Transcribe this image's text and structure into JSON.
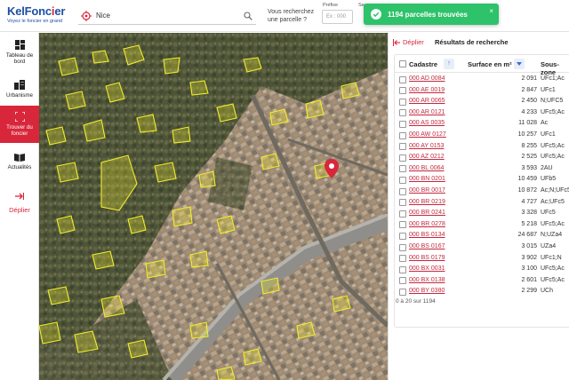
{
  "header": {
    "logo_main_a": "KelFonc",
    "logo_main_b": "i",
    "logo_main_c": "er",
    "logo_tagline": "Voyez le foncier en grand",
    "search_value": "Nice",
    "question": "Vous recherchez une parcelle ?",
    "prefix_label": "Préfixe",
    "prefix_placeholder": "Ex : 000",
    "section_label": "Se"
  },
  "toast": {
    "message": "1194 parcelles trouvées",
    "close": "×",
    "color": "#2ec26a"
  },
  "sidebar": {
    "items": [
      {
        "label": "Tableau de bord",
        "icon": "dashboard-icon"
      },
      {
        "label": "Urbanisme",
        "icon": "buildings-icon"
      },
      {
        "label": "Trouver du foncier",
        "icon": "expand-frame-icon",
        "active": true
      },
      {
        "label": "Actualités",
        "icon": "book-icon"
      }
    ],
    "deplier": "Déplier",
    "accent": "#d8263b"
  },
  "panel": {
    "deplier": "Déplier",
    "title": "Résultats de recherche",
    "columns": [
      "Cadastre",
      "Surface en m²",
      "Sous-zone"
    ],
    "rows": [
      {
        "cadastre": "000 AD 0084",
        "surface": "2 091",
        "zone": "UFc1;Ac"
      },
      {
        "cadastre": "000 AE 0019",
        "surface": "2 847",
        "zone": "UFc1"
      },
      {
        "cadastre": "000 AR 0065",
        "surface": "2 450",
        "zone": "N;UFC5"
      },
      {
        "cadastre": "000 AR 0121",
        "surface": "4 233",
        "zone": "UFc5;Ac"
      },
      {
        "cadastre": "000 AS 0035",
        "surface": "11 028",
        "zone": "Ac"
      },
      {
        "cadastre": "000 AW 0127",
        "surface": "10 257",
        "zone": "UFc1"
      },
      {
        "cadastre": "000 AY 0153",
        "surface": "8 255",
        "zone": "UFc5;Ac"
      },
      {
        "cadastre": "000 AZ 0212",
        "surface": "2 525",
        "zone": "UFc5;Ac"
      },
      {
        "cadastre": "000 BL 0064",
        "surface": "3 593",
        "zone": "2AU"
      },
      {
        "cadastre": "000 BN 0201",
        "surface": "10 459",
        "zone": "UFb5"
      },
      {
        "cadastre": "000 BR 0017",
        "surface": "10 872",
        "zone": "Ac;N;UFc5"
      },
      {
        "cadastre": "000 BR 0219",
        "surface": "4 727",
        "zone": "Ac;UFc5"
      },
      {
        "cadastre": "000 BR 0241",
        "surface": "3 328",
        "zone": "UFc5"
      },
      {
        "cadastre": "000 BR 0278",
        "surface": "5 218",
        "zone": "UFc5;Ac"
      },
      {
        "cadastre": "000 BS 0134",
        "surface": "24 687",
        "zone": "N;UZa4"
      },
      {
        "cadastre": "000 BS 0167",
        "surface": "3 015",
        "zone": "UZa4"
      },
      {
        "cadastre": "000 BS 0179",
        "surface": "3 902",
        "zone": "UFc1;N"
      },
      {
        "cadastre": "000 BX 0031",
        "surface": "3 100",
        "zone": "UFc5;Ac"
      },
      {
        "cadastre": "000 BX 0138",
        "surface": "2 601",
        "zone": "UFc5;Ac"
      },
      {
        "cadastre": "000 BY 0380",
        "surface": "2 299",
        "zone": "UCh"
      }
    ],
    "pagination": "0 à 20 sur 1194"
  },
  "map": {
    "parcel_color": "#f2ee2a",
    "marker_color": "#d8263b"
  }
}
